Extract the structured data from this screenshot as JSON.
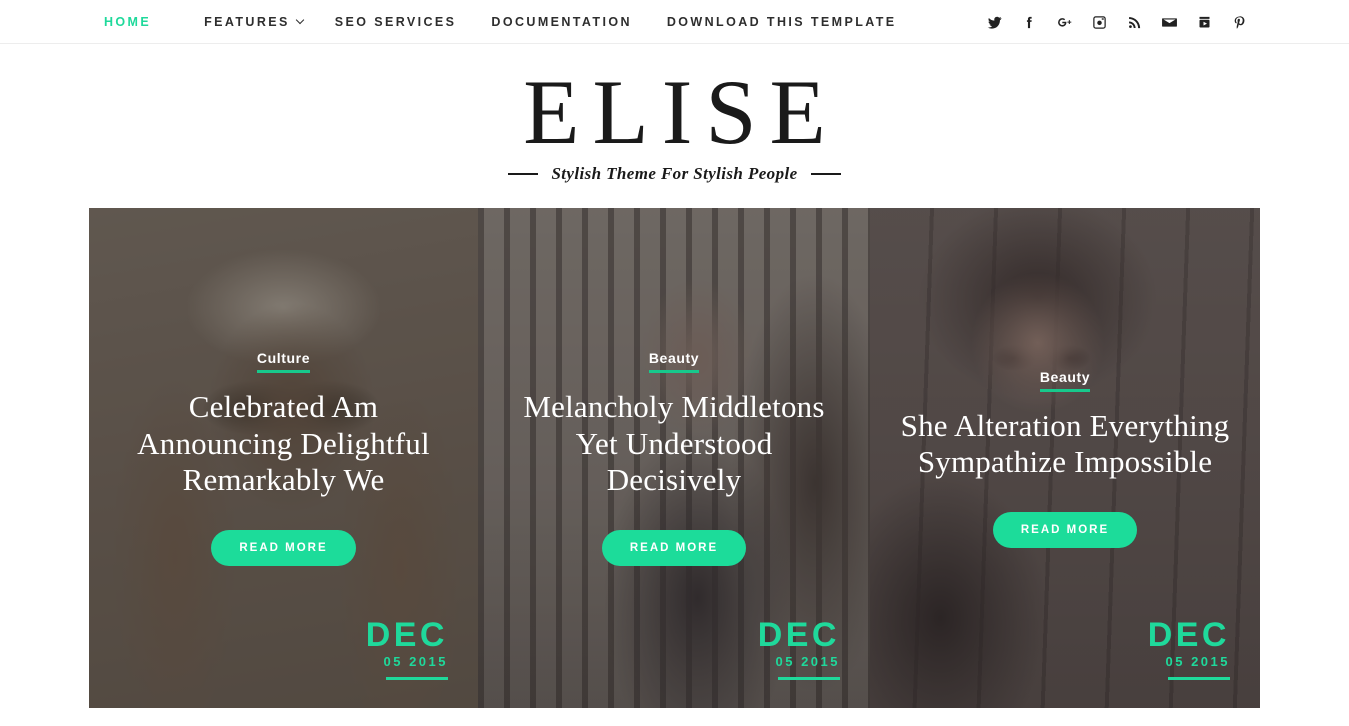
{
  "nav": {
    "items": [
      {
        "label": "HOME",
        "active": true,
        "has_submenu": false
      },
      {
        "label": "FEATURES",
        "active": false,
        "has_submenu": true
      },
      {
        "label": "SEO SERVICES",
        "active": false,
        "has_submenu": false
      },
      {
        "label": "DOCUMENTATION",
        "active": false,
        "has_submenu": false
      },
      {
        "label": "DOWNLOAD THIS TEMPLATE",
        "active": false,
        "has_submenu": false
      }
    ],
    "social": [
      {
        "name": "twitter-icon",
        "title": "Twitter"
      },
      {
        "name": "facebook-icon",
        "title": "Facebook"
      },
      {
        "name": "google-plus-icon",
        "title": "Google Plus"
      },
      {
        "name": "instagram-icon",
        "title": "Instagram"
      },
      {
        "name": "rss-icon",
        "title": "RSS"
      },
      {
        "name": "email-icon",
        "title": "Email"
      },
      {
        "name": "youtube-icon",
        "title": "YouTube"
      },
      {
        "name": "pinterest-icon",
        "title": "Pinterest"
      }
    ]
  },
  "logo": {
    "title": "ELISE",
    "tagline": "Stylish Theme For Stylish People"
  },
  "colors": {
    "accent": "#1fd99b",
    "button": "#1cdc9a",
    "underline": "#17c98c",
    "text": "#2e2e2e",
    "border": "#ededed"
  },
  "slider": {
    "slides": [
      {
        "category": "Culture",
        "title": "Celebrated Am Announcing Delightful Remarkably We",
        "button": "READ MORE",
        "date_month": "DEC",
        "date_day": "05 2015"
      },
      {
        "category": "Beauty",
        "title": "Melancholy Middletons Yet Understood Decisively",
        "button": "READ MORE",
        "date_month": "DEC",
        "date_day": "05 2015"
      },
      {
        "category": "Beauty",
        "title": "She Alteration Everything Sympathize Impossible",
        "button": "READ MORE",
        "date_month": "DEC",
        "date_day": "05 2015"
      }
    ]
  }
}
